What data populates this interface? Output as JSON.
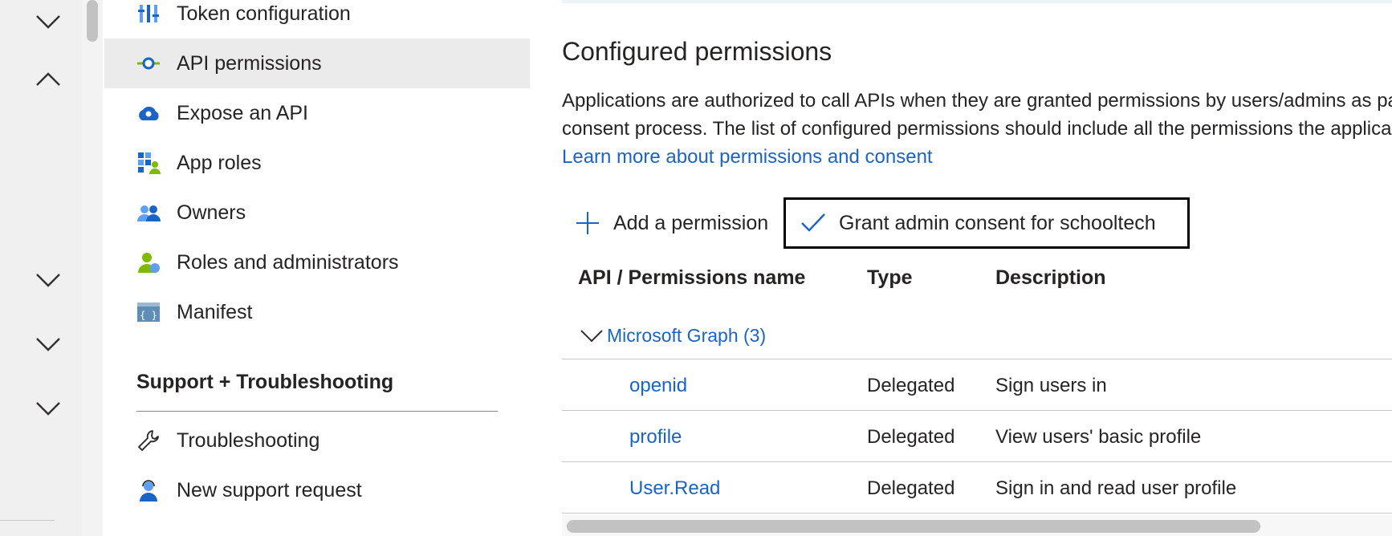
{
  "nav": {
    "items": [
      {
        "label": "Token configuration",
        "icon": "token-config-icon"
      },
      {
        "label": "API permissions",
        "icon": "api-permissions-icon",
        "active": true
      },
      {
        "label": "Expose an API",
        "icon": "cloud-gear-icon"
      },
      {
        "label": "App roles",
        "icon": "app-roles-icon"
      },
      {
        "label": "Owners",
        "icon": "owners-icon"
      },
      {
        "label": "Roles and administrators",
        "icon": "roles-admin-icon"
      },
      {
        "label": "Manifest",
        "icon": "manifest-icon"
      }
    ],
    "support_section": "Support + Troubleshooting",
    "support_items": [
      {
        "label": "Troubleshooting",
        "icon": "wrench-icon"
      },
      {
        "label": "New support request",
        "icon": "support-person-icon"
      }
    ]
  },
  "main": {
    "title": "Configured permissions",
    "description_line1": "Applications are authorized to call APIs when they are granted permissions by users/admins as part of the",
    "description_line2": "consent process. The list of configured permissions should include all the permissions the application needs.",
    "learn_more": "Learn more about permissions and consent",
    "toolbar": {
      "add_label": "Add a permission",
      "grant_label": "Grant admin consent for schooltech"
    },
    "table": {
      "headers": [
        "API / Permissions name",
        "Type",
        "Description"
      ],
      "group_label": "Microsoft Graph (3)",
      "rows": [
        {
          "name": "openid",
          "type": "Delegated",
          "description": "Sign users in"
        },
        {
          "name": "profile",
          "type": "Delegated",
          "description": "View users' basic profile"
        },
        {
          "name": "User.Read",
          "type": "Delegated",
          "description": "Sign in and read user profile"
        }
      ]
    }
  },
  "colors": {
    "link": "#1a64c5",
    "active_bg": "#ebebeb",
    "highlight_border": "#000000"
  }
}
